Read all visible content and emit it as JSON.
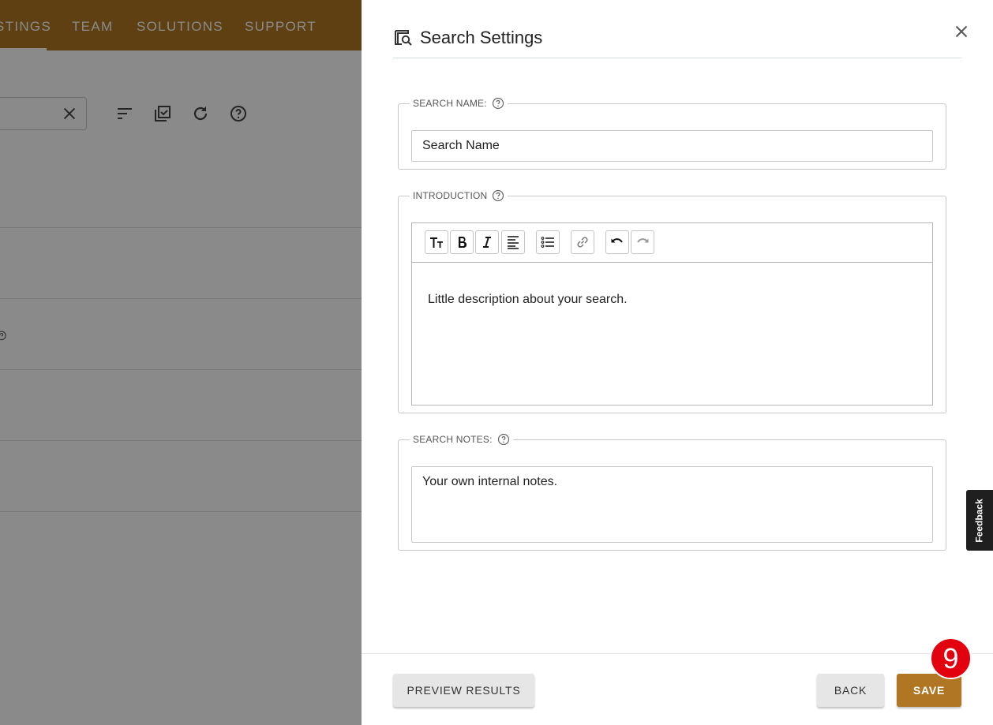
{
  "background_app": {
    "nav_items": [
      "STINGS",
      "TEAM",
      "SOLUTIONS",
      "SUPPORT"
    ],
    "brand_color": "#b07623"
  },
  "drawer": {
    "title": "Search Settings",
    "sections": {
      "search_name": {
        "label": "SEARCH NAME:",
        "value": "Search Name"
      },
      "introduction": {
        "label": "INTRODUCTION",
        "toolbar": [
          "text-size-icon",
          "bold-icon",
          "italic-icon",
          "align-left-icon",
          "bulleted-list-icon",
          "link-icon",
          "undo-icon",
          "redo-icon"
        ],
        "content": "Little description about your search."
      },
      "search_notes": {
        "label": "SEARCH NOTES:",
        "value": "Your own internal notes."
      }
    },
    "footer": {
      "preview_label": "PREVIEW RESULTS",
      "back_label": "BACK",
      "save_label": "SAVE"
    }
  },
  "step_badge": "9",
  "feedback_label": "Feedback",
  "colors": {
    "accent": "#b07623",
    "badge": "#e3000f"
  }
}
